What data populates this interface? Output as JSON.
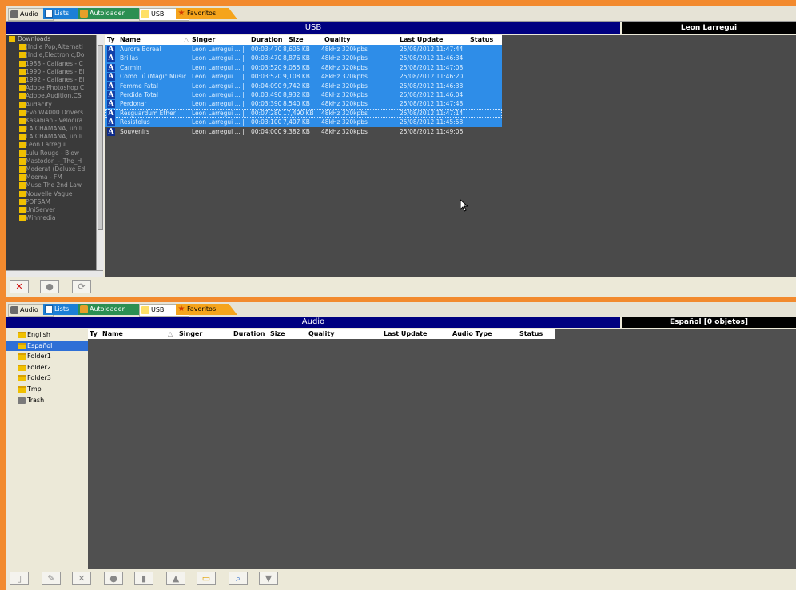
{
  "tabs": [
    {
      "label": "Audio"
    },
    {
      "label": "Lists"
    },
    {
      "label": "Autoloader"
    },
    {
      "label": "USB"
    },
    {
      "label": "Favoritos"
    }
  ],
  "top": {
    "title": "USB",
    "right_title": "Leon Larregui",
    "tree": {
      "root": "Downloads",
      "items": [
        "(Indie Pop,Alternati",
        "(Indie,Electronic,Do",
        "1988 - Caifanes - C",
        "1990 - Caifanes - El",
        "1992 - Caifanes - El",
        "Adobe Photoshop C",
        "Adobe.Audition.CS",
        "Audacity",
        "Evo W4000 Drivers",
        "Kasabian - Velocira",
        "LA CHAMANA, un li",
        "LA CHAMANA, un li",
        "Leon Larregui",
        "Lulu Rouge - Blow",
        "Mastodon_-_The_H",
        "Moderat (Deluxe Ed",
        "Moema - FM",
        "Muse The 2nd Law",
        "Nouvelle Vague",
        "PDFSAM",
        "UniServer",
        "Winmedia"
      ]
    },
    "columns": [
      "Ty",
      "Name",
      "Singer",
      "Duration",
      "Size",
      "Quality",
      "Last Update",
      "Status"
    ],
    "rows": [
      {
        "ty": "A",
        "name": "Aurora Boreal",
        "singer": "Leon Larregui ... |",
        "duration": "00:03:470",
        "size": "8,605 KB",
        "quality": "48kHz 320kpbs",
        "updated": "25/08/2012 11:47:44",
        "sel": true
      },
      {
        "ty": "A",
        "name": "Brillas",
        "singer": "Leon Larregui ... |",
        "duration": "00:03:470",
        "size": "8,876 KB",
        "quality": "48kHz 320kpbs",
        "updated": "25/08/2012 11:46:34",
        "sel": true
      },
      {
        "ty": "A",
        "name": "Carmin",
        "singer": "Leon Larregui ... |",
        "duration": "00:03:520",
        "size": "9,055 KB",
        "quality": "48kHz 320kpbs",
        "updated": "25/08/2012 11:47:08",
        "sel": true
      },
      {
        "ty": "A",
        "name": "Como Tú (Magic Music B",
        "singer": "Leon Larregui ... |",
        "duration": "00:03:520",
        "size": "9,108 KB",
        "quality": "48kHz 320kpbs",
        "updated": "25/08/2012 11:46:20",
        "sel": true
      },
      {
        "ty": "A",
        "name": "Femme Fatal",
        "singer": "Leon Larregui ... |",
        "duration": "00:04:090",
        "size": "9,742 KB",
        "quality": "48kHz 320kpbs",
        "updated": "25/08/2012 11:46:38",
        "sel": true
      },
      {
        "ty": "A",
        "name": "Perdida Total",
        "singer": "Leon Larregui ... |",
        "duration": "00:03:490",
        "size": "8,932 KB",
        "quality": "48kHz 320kpbs",
        "updated": "25/08/2012 11:46:04",
        "sel": true
      },
      {
        "ty": "A",
        "name": "Perdonar",
        "singer": "Leon Larregui ... |",
        "duration": "00:03:390",
        "size": "8,540 KB",
        "quality": "48kHz 320kpbs",
        "updated": "25/08/2012 11:47:48",
        "sel": true
      },
      {
        "ty": "A",
        "name": "Resguardum Ether",
        "singer": "Leon Larregui ... |",
        "duration": "00:07:280",
        "size": "17,490 KB",
        "quality": "48kHz 320kpbs",
        "updated": "25/08/2012 11:47:14",
        "sel": true,
        "cur": true
      },
      {
        "ty": "A",
        "name": "Resistolus",
        "singer": "Leon Larregui ... |",
        "duration": "00:03:100",
        "size": "7,407 KB",
        "quality": "48kHz 320kpbs",
        "updated": "25/08/2012 11:45:58",
        "sel": true
      },
      {
        "ty": "A",
        "name": "Souvenirs",
        "singer": "Leon Larregui ... |",
        "duration": "00:04:000",
        "size": "9,382 KB",
        "quality": "48kHz 320kpbs",
        "updated": "25/08/2012 11:49:06",
        "sel": false
      }
    ]
  },
  "bottom": {
    "title": "Audio",
    "right_title": "Español [0 objetos]",
    "tree": [
      {
        "label": "English",
        "icon": "folder-icon"
      },
      {
        "label": "Español",
        "icon": "folder-icon",
        "selected": true
      },
      {
        "label": "Folder1",
        "icon": "folder-icon"
      },
      {
        "label": "Folder2",
        "icon": "folder-icon"
      },
      {
        "label": "Folder3",
        "icon": "folder-icon"
      },
      {
        "label": "Tmp",
        "icon": "folder-icon"
      },
      {
        "label": "Trash",
        "icon": "trash-icon"
      }
    ],
    "columns": [
      "Ty",
      "Name",
      "Singer",
      "Duration",
      "Size",
      "Quality",
      "Last Update",
      "Audio Type",
      "Status"
    ]
  },
  "colors": {
    "accent_orange": "#f28a2e",
    "title_blue": "#000080",
    "selection_blue": "#2e8de8"
  }
}
